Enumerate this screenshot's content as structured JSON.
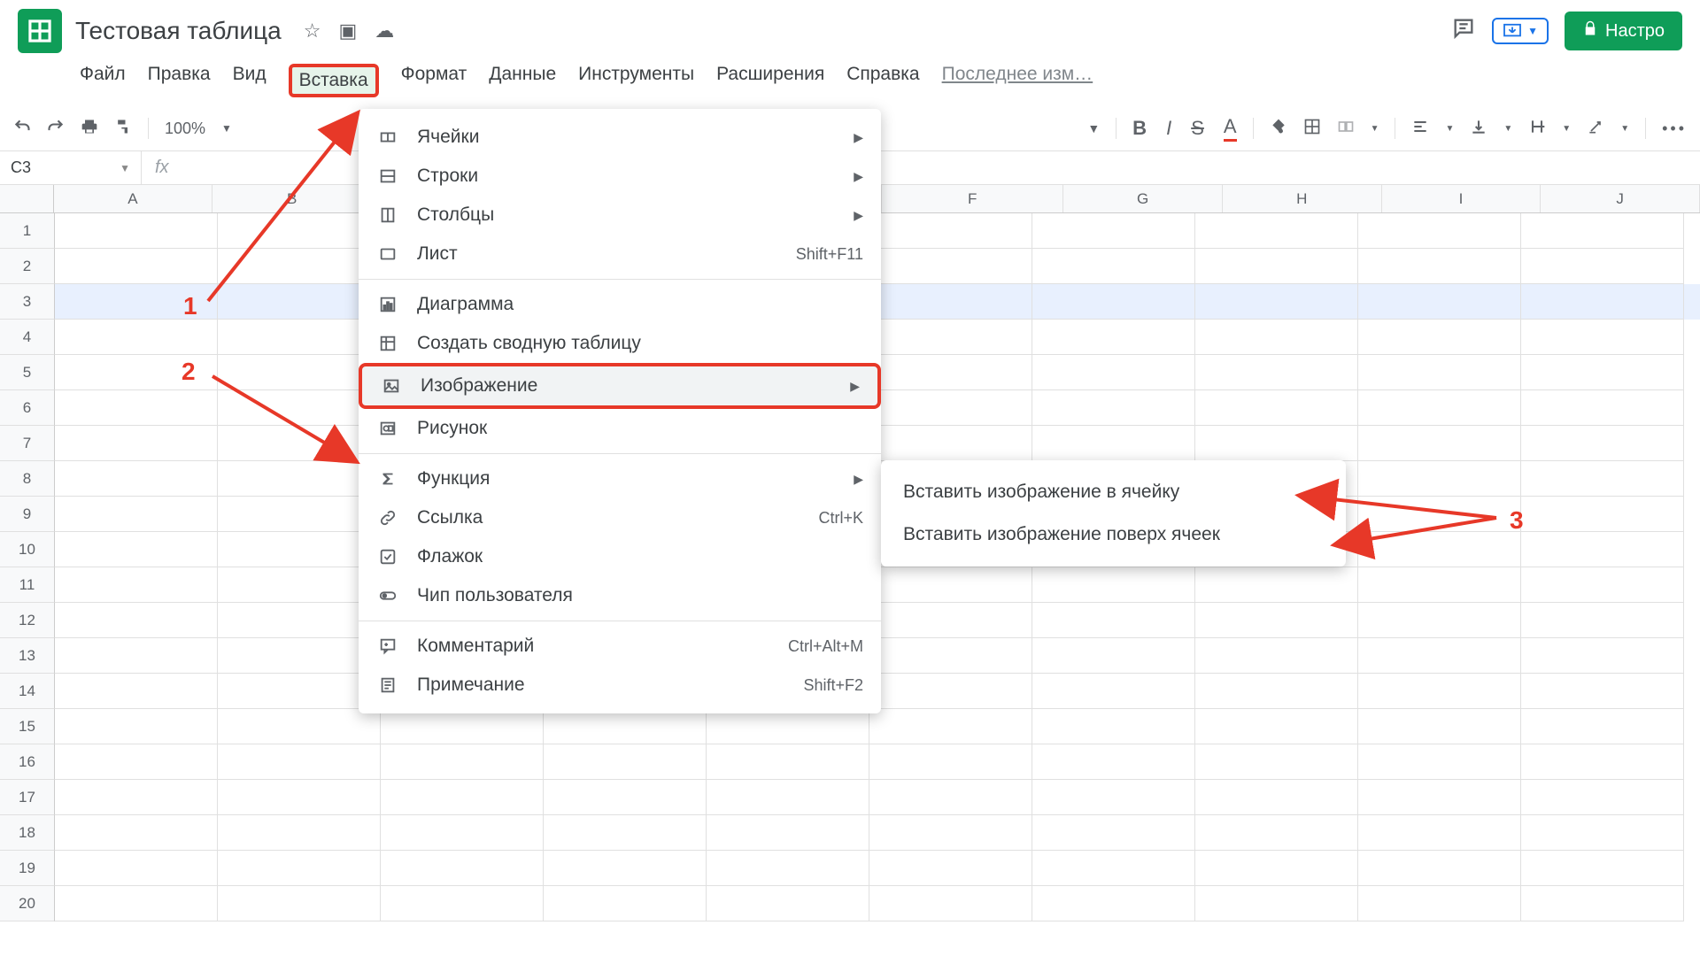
{
  "doc_title": "Тестовая таблица",
  "menu": [
    "Файл",
    "Правка",
    "Вид",
    "Вставка",
    "Формат",
    "Данные",
    "Инструменты",
    "Расширения",
    "Справка"
  ],
  "last_change": "Последнее изм…",
  "settings_btn": "Настро",
  "zoom": "100%",
  "namebox": "C3",
  "fx": "fx",
  "columns": [
    "A",
    "B",
    "G",
    "H",
    "I",
    "J"
  ],
  "col_wide": [
    "F"
  ],
  "rows": [
    "1",
    "2",
    "3",
    "4",
    "5",
    "6",
    "7",
    "8",
    "9",
    "10",
    "11",
    "12",
    "13",
    "14",
    "15",
    "16",
    "17",
    "18",
    "19",
    "20"
  ],
  "dropdown": {
    "group1": [
      {
        "icon": "cells",
        "label": "Ячейки",
        "arrow": true
      },
      {
        "icon": "rows",
        "label": "Строки",
        "arrow": true
      },
      {
        "icon": "cols",
        "label": "Столбцы",
        "arrow": true
      },
      {
        "icon": "sheet",
        "label": "Лист",
        "sc": "Shift+F11"
      }
    ],
    "group2": [
      {
        "icon": "chart",
        "label": "Диаграмма"
      },
      {
        "icon": "pivot",
        "label": "Создать сводную таблицу"
      },
      {
        "icon": "image",
        "label": "Изображение",
        "arrow": true,
        "boxed": true,
        "hover": true
      },
      {
        "icon": "drawing",
        "label": "Рисунок"
      }
    ],
    "group3": [
      {
        "icon": "sigma",
        "label": "Функция",
        "arrow": true
      },
      {
        "icon": "link",
        "label": "Ссылка",
        "sc": "Ctrl+K"
      },
      {
        "icon": "check",
        "label": "Флажок"
      },
      {
        "icon": "chip",
        "label": "Чип пользователя"
      }
    ],
    "group4": [
      {
        "icon": "comment",
        "label": "Комментарий",
        "sc": "Ctrl+Alt+M"
      },
      {
        "icon": "note",
        "label": "Примечание",
        "sc": "Shift+F2"
      }
    ]
  },
  "submenu": [
    "Вставить изображение в ячейку",
    "Вставить изображение поверх ячеек"
  ],
  "annotations": {
    "a1": "1",
    "a2": "2",
    "a3": "3"
  }
}
